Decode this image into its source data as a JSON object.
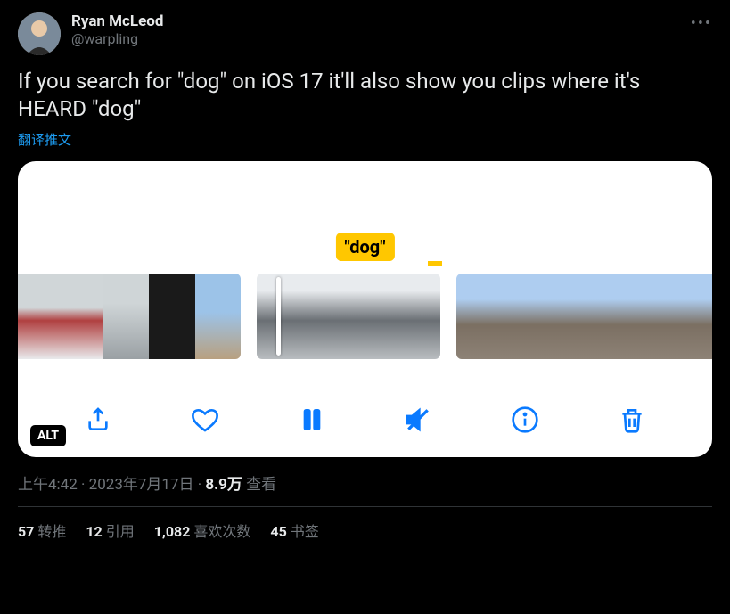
{
  "author": {
    "display_name": "Ryan McLeod",
    "handle": "@warpling"
  },
  "tweet_text": "If you search for \"dog\" on iOS 17 it'll also show you clips where it's HEARD \"dog\"",
  "translate_label": "翻译推文",
  "media": {
    "search_tag": "\"dog\"",
    "alt_badge": "ALT"
  },
  "timestamp": {
    "time": "上午4:42",
    "date": "2023年7月17日",
    "views_count": "8.9万",
    "views_label": "查看"
  },
  "stats": {
    "retweets": {
      "count": "57",
      "label": "转推"
    },
    "quotes": {
      "count": "12",
      "label": "引用"
    },
    "likes": {
      "count": "1,082",
      "label": "喜欢次数"
    },
    "bookmarks": {
      "count": "45",
      "label": "书签"
    }
  }
}
